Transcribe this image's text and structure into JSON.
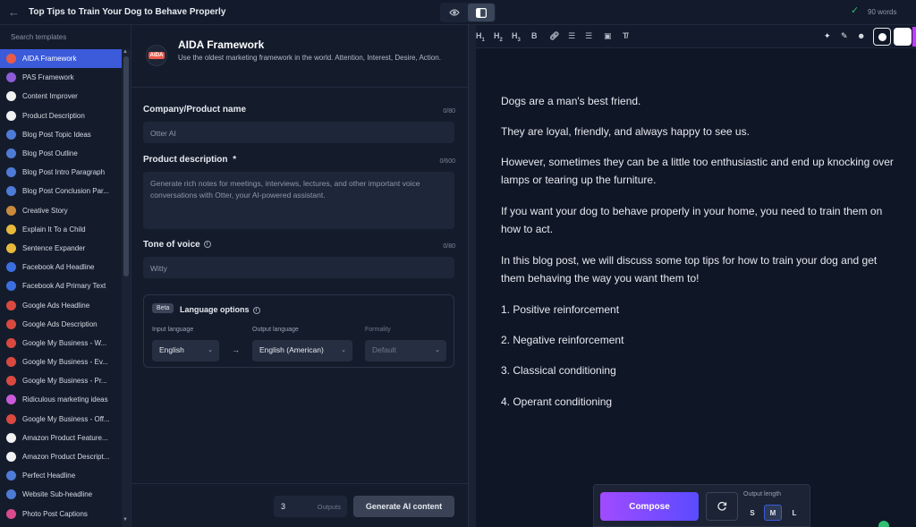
{
  "topbar": {
    "title": "Top Tips to Train Your Dog to Behave Properly",
    "word_count": "90 words"
  },
  "sidebar": {
    "search_placeholder": "Search templates",
    "items": [
      {
        "label": "AIDA Framework",
        "icon_color": "#e85b4a",
        "active": true
      },
      {
        "label": "PAS Framework",
        "icon_color": "#8e5bd8"
      },
      {
        "label": "Content Improver",
        "icon_color": "#f2f2f2"
      },
      {
        "label": "Product Description",
        "icon_color": "#f2f2f2"
      },
      {
        "label": "Blog Post Topic Ideas",
        "icon_color": "#4e7bd6"
      },
      {
        "label": "Blog Post Outline",
        "icon_color": "#4e7bd6"
      },
      {
        "label": "Blog Post Intro Paragraph",
        "icon_color": "#4e7bd6"
      },
      {
        "label": "Blog Post Conclusion Par...",
        "icon_color": "#4e7bd6"
      },
      {
        "label": "Creative Story",
        "icon_color": "#c98a3c"
      },
      {
        "label": "Explain It To a Child",
        "icon_color": "#e8b93a"
      },
      {
        "label": "Sentence Expander",
        "icon_color": "#e8b93a"
      },
      {
        "label": "Facebook Ad Headline",
        "icon_color": "#3b6fe0"
      },
      {
        "label": "Facebook Ad Primary Text",
        "icon_color": "#3b6fe0"
      },
      {
        "label": "Google Ads Headline",
        "icon_color": "#d9493f"
      },
      {
        "label": "Google Ads Description",
        "icon_color": "#d9493f"
      },
      {
        "label": "Google My Business - W...",
        "icon_color": "#d9493f"
      },
      {
        "label": "Google My Business - Ev...",
        "icon_color": "#d9493f"
      },
      {
        "label": "Google My Business - Pr...",
        "icon_color": "#d9493f"
      },
      {
        "label": "Ridiculous marketing ideas",
        "icon_color": "#c95bd8"
      },
      {
        "label": "Google My Business - Off...",
        "icon_color": "#d9493f"
      },
      {
        "label": "Amazon Product Feature...",
        "icon_color": "#f2f2f2"
      },
      {
        "label": "Amazon Product Descript...",
        "icon_color": "#f2f2f2"
      },
      {
        "label": "Perfect Headline",
        "icon_color": "#4e7bd6"
      },
      {
        "label": "Website Sub-headline",
        "icon_color": "#4e7bd6"
      },
      {
        "label": "Photo Post Captions",
        "icon_color": "#d94b8a"
      }
    ]
  },
  "form": {
    "logo_text": "AIDA",
    "title": "AIDA Framework",
    "description": "Use the oldest marketing framework in the world. Attention, Interest, Desire, Action.",
    "company": {
      "label": "Company/Product name",
      "counter": "0/80",
      "placeholder": "Otter AI"
    },
    "product": {
      "label": "Product description",
      "required": "*",
      "counter": "0/600",
      "placeholder": "Generate rich notes for meetings, interviews, lectures, and other important voice conversations with Otter, your AI-powered assistant."
    },
    "tone": {
      "label": "Tone of voice",
      "counter": "0/80",
      "placeholder": "Witty"
    },
    "language": {
      "badge": "Beta",
      "title": "Language options",
      "input_label": "Input language",
      "input_value": "English",
      "arrow": "→",
      "output_label": "Output language",
      "output_value": "English (American)",
      "formality_label": "Formality",
      "formality_value": "Default"
    },
    "outputs_value": "3",
    "outputs_label": "Outputs",
    "generate_label": "Generate AI content"
  },
  "editor": {
    "toolbar": [
      "H1",
      "H2",
      "H3",
      "B"
    ],
    "paragraphs": [
      "Dogs are a man's best friend.",
      "They are loyal, friendly, and always happy to see us.",
      "However, sometimes they can be a little too enthusiastic and end up knocking over lamps or tearing up the furniture.",
      "If you want your dog to behave properly in your home, you need to train them on how to act.",
      "In this blog post, we will discuss some top tips for how to train your dog and get them behaving the way you want them to!",
      "1. Positive reinforcement",
      "2. Negative reinforcement",
      "3. Classical conditioning",
      "4. Operant conditioning"
    ],
    "compose_label": "Compose",
    "output_length_label": "Output length",
    "lengths": [
      "S",
      "M",
      "L"
    ],
    "selected_length": "M"
  }
}
